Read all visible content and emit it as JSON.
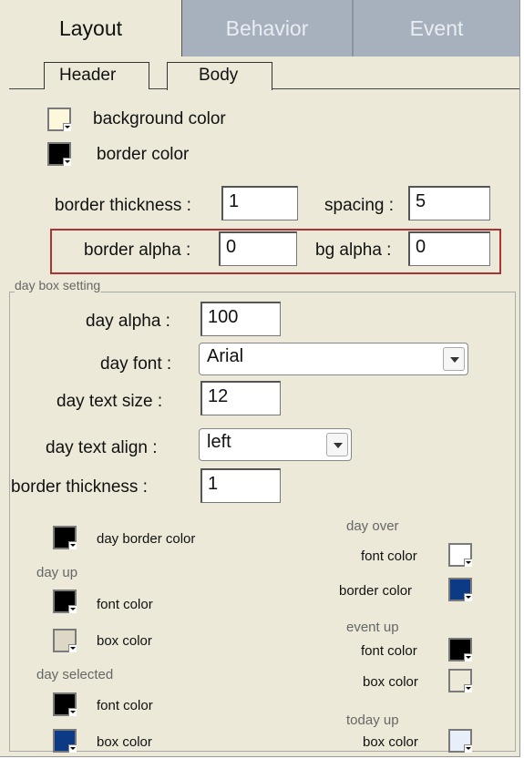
{
  "tabs": {
    "layout": "Layout",
    "behavior": "Behavior",
    "event": "Event"
  },
  "subtabs": {
    "header": "Header",
    "body": "Body"
  },
  "body": {
    "background_color_label": "background color",
    "border_color_label": "border color",
    "border_thickness_label": "border thickness :",
    "border_thickness_value": "1",
    "spacing_label": "spacing :",
    "spacing_value": "5",
    "border_alpha_label": "border alpha :",
    "border_alpha_value": "0",
    "bg_alpha_label": "bg alpha :",
    "bg_alpha_value": "0"
  },
  "day_box": {
    "title": "day box setting",
    "day_alpha_label": "day alpha :",
    "day_alpha_value": "100",
    "day_font_label": "day font :",
    "day_font_value": "Arial",
    "day_text_size_label": "day text size :",
    "day_text_size_value": "12",
    "day_text_align_label": "day text align :",
    "day_text_align_value": "left",
    "border_thickness_label": "border thickness :",
    "border_thickness_value": "1",
    "day_border_color_label": "day border color",
    "day_up_title": "day up",
    "day_up_font_color": "font color",
    "day_up_box_color": "box color",
    "day_selected_title": "day selected",
    "day_selected_font_color": "font color",
    "day_selected_box_color": "box color",
    "day_over_title": "day  over",
    "day_over_font_color": "font color",
    "day_over_border_color": "border color",
    "event_up_title": "event up",
    "event_up_font_color": "font color",
    "event_up_box_color": "box color",
    "today_up_title": "today up",
    "today_up_box_color": "box color"
  },
  "colors": {
    "background_color": "#fdf8dc",
    "border_color": "#000000",
    "day_border_color": "#000000",
    "day_up_font": "#000000",
    "day_up_box": "#ddd8c6",
    "day_selected_font": "#000000",
    "day_selected_box": "#0c3a84",
    "day_over_font": "#ffffff",
    "day_over_border": "#0c3a84",
    "event_up_font": "#000000",
    "event_up_box": "#ece9d8",
    "today_up_box": "#e6effa"
  }
}
